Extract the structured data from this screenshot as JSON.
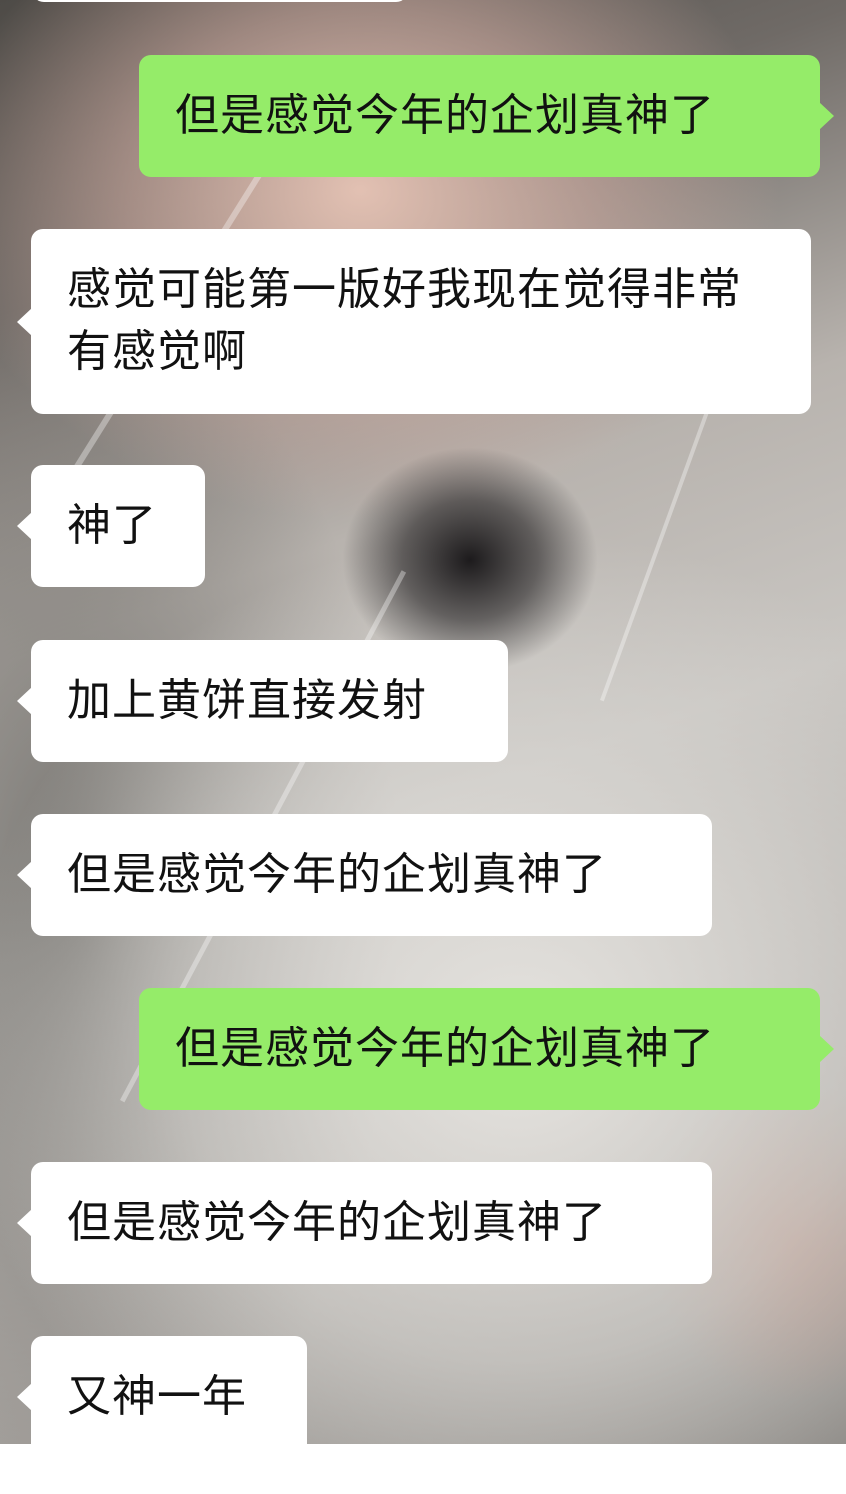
{
  "chat": {
    "messages": [
      {
        "side": "out",
        "text": "但是感觉今年的企划真神了"
      },
      {
        "side": "in",
        "text": "感觉可能第一版好我现在觉得非常有感觉啊"
      },
      {
        "side": "in",
        "text": "神了"
      },
      {
        "side": "in",
        "text": "加上黄饼直接发射"
      },
      {
        "side": "in",
        "text": "但是感觉今年的企划真神了"
      },
      {
        "side": "out",
        "text": "但是感觉今年的企划真神了"
      },
      {
        "side": "in",
        "text": "但是感觉今年的企划真神了"
      },
      {
        "side": "in",
        "text": "又神一年"
      }
    ]
  },
  "colors": {
    "outgoing_bubble": "#95ec69",
    "incoming_bubble": "#ffffff",
    "text": "#111111"
  }
}
